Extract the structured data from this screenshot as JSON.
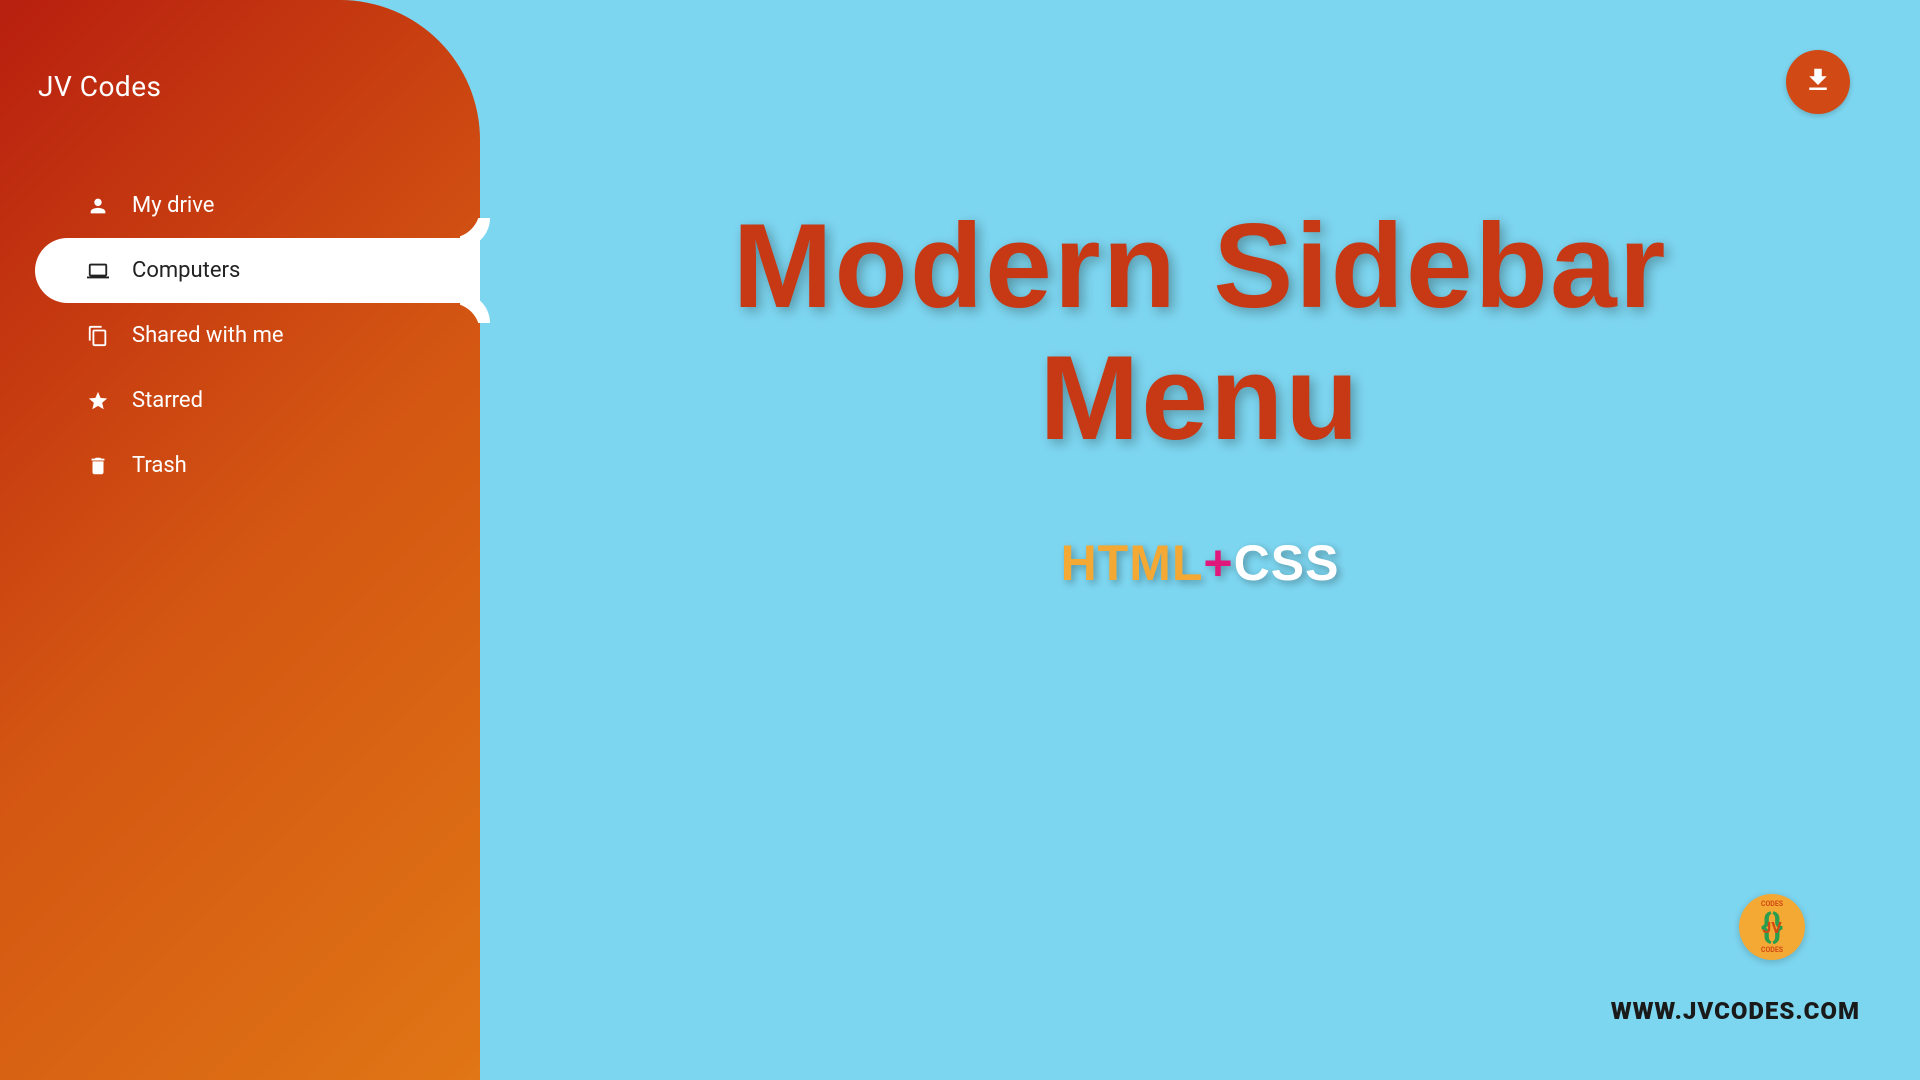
{
  "sidebar": {
    "title": "JV Codes",
    "items": [
      {
        "label": "My drive",
        "icon": "person-icon",
        "active": false
      },
      {
        "label": "Computers",
        "icon": "laptop-icon",
        "active": true
      },
      {
        "label": "Shared with me",
        "icon": "shared-icon",
        "active": false
      },
      {
        "label": "Starred",
        "icon": "star-icon",
        "active": false
      },
      {
        "label": "Trash",
        "icon": "trash-icon",
        "active": false
      }
    ]
  },
  "main": {
    "title_line1": "Modern Sidebar",
    "title_line2": "Menu",
    "subtitle_html": "HTML",
    "subtitle_plus": "+",
    "subtitle_css": "CSS"
  },
  "footer": {
    "url": "WWW.JVCODES.COM",
    "logo_text": "JV",
    "logo_sub": "CODES"
  },
  "colors": {
    "background": "#7dd6f0",
    "sidebar_gradient_start": "#b81f0f",
    "sidebar_gradient_end": "#e07615",
    "title_color": "#c73915",
    "html_color": "#f4a935",
    "plus_color": "#e0187c",
    "css_color": "#ffffff"
  }
}
